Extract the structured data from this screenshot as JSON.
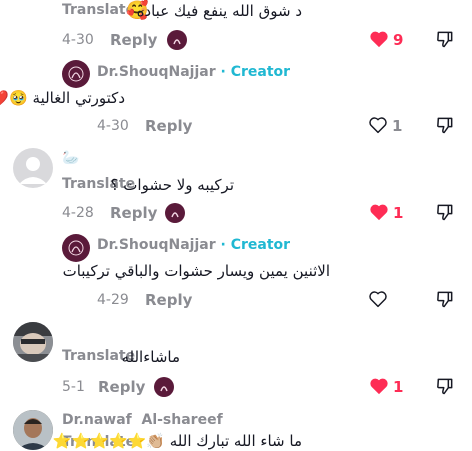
{
  "comments": [
    {
      "translate_label": "Translate",
      "emoji": "🥰",
      "text": "د شوق الله ينفع فيك عباده",
      "date": "4-30",
      "reply_label": "Reply",
      "likes": "9",
      "liked": true,
      "reply": {
        "author": "Dr.ShouqNajjar",
        "separator": "·",
        "badge": "Creator",
        "text": "دكتورتي الغالية 🥹❤️",
        "date": "4-30",
        "reply_label": "Reply",
        "likes": "1",
        "liked": false
      }
    },
    {
      "author_emoji": "🦢",
      "translate_label": "Translate",
      "text": "تركيبه ولا حشوات ؟",
      "date": "4-28",
      "reply_label": "Reply",
      "likes": "1",
      "liked": true,
      "reply": {
        "author": "Dr.ShouqNajjar",
        "separator": "·",
        "badge": "Creator",
        "text": "الاثنين يمين ويسار حشوات والباقي تركيبات",
        "date": "4-29",
        "reply_label": "Reply",
        "likes": "",
        "liked": false
      }
    },
    {
      "translate_label": "Translate",
      "text": "ماشاءالله",
      "date": "5-1",
      "reply_label": "Reply",
      "likes": "1",
      "liked": true
    },
    {
      "author": "Dr.nawaf  Al-shareef",
      "translate_label": "Translate",
      "text": "ما شاء الله تبارك الله 👏🏼⭐⭐⭐⭐⭐"
    }
  ],
  "colors": {
    "heart_red": "#fe2c55",
    "creator": "#20b8d2",
    "muted": "#8a8b91"
  }
}
